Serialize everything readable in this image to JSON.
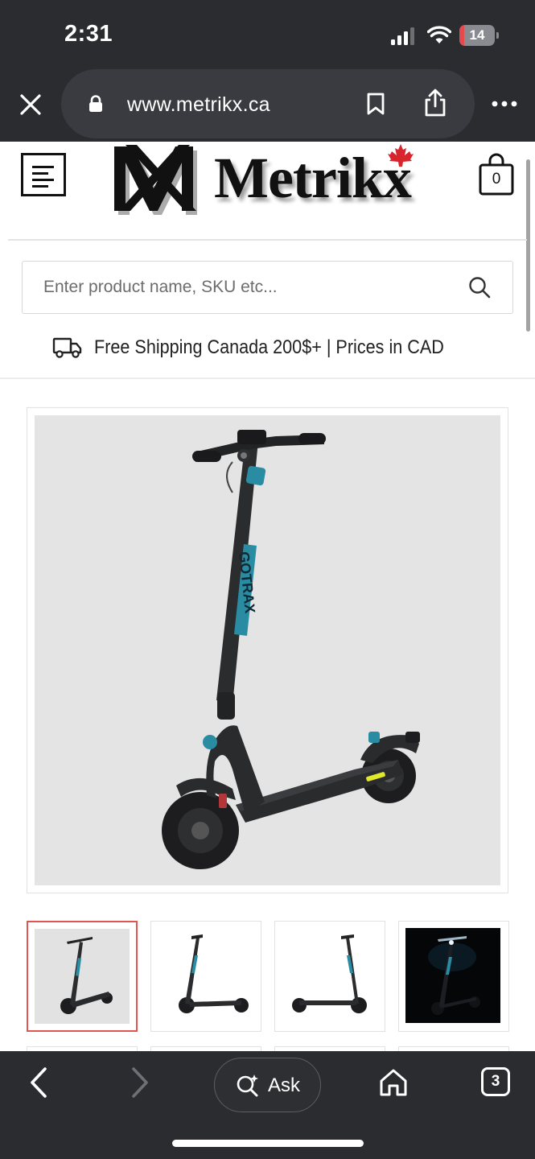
{
  "status_bar": {
    "time": "2:31",
    "battery_level": "14",
    "battery_fraction": 0.14,
    "battery_color": "#e5484d",
    "icons": [
      "signal-icon",
      "wifi-icon",
      "battery-charging-icon"
    ]
  },
  "browser": {
    "url": "www.metrikx.ca",
    "icons": [
      "close-icon",
      "lock-icon",
      "bookmark-icon",
      "share-icon",
      "more-icon"
    ]
  },
  "header": {
    "brand_name": "Metrikx",
    "logo_monogram": "MX",
    "cart_count": "0",
    "icons": [
      "menu-icon",
      "maple-leaf-icon",
      "shopping-bag-icon"
    ]
  },
  "search": {
    "placeholder": "Enter product name, SKU etc...",
    "value": ""
  },
  "shipping_banner": {
    "text": "Free Shipping Canada 200$+ | Prices in CAD"
  },
  "product_gallery": {
    "main_image": "electric-scooter-image",
    "accent_color": "#2a8ca3",
    "selected_thumbnail_index": 0,
    "selected_border_color": "#e0554f",
    "thumbnails": [
      {
        "name": "scooter-front-angle",
        "dark": false
      },
      {
        "name": "scooter-side-left",
        "dark": false
      },
      {
        "name": "scooter-side-right",
        "dark": false
      },
      {
        "name": "scooter-night-lights",
        "dark": true
      }
    ]
  },
  "bottom_toolbar": {
    "ask_label": "Ask",
    "tab_count": "3",
    "icons": [
      "back-icon",
      "forward-icon",
      "sparkle-search-icon",
      "home-icon",
      "tabs-icon"
    ]
  }
}
